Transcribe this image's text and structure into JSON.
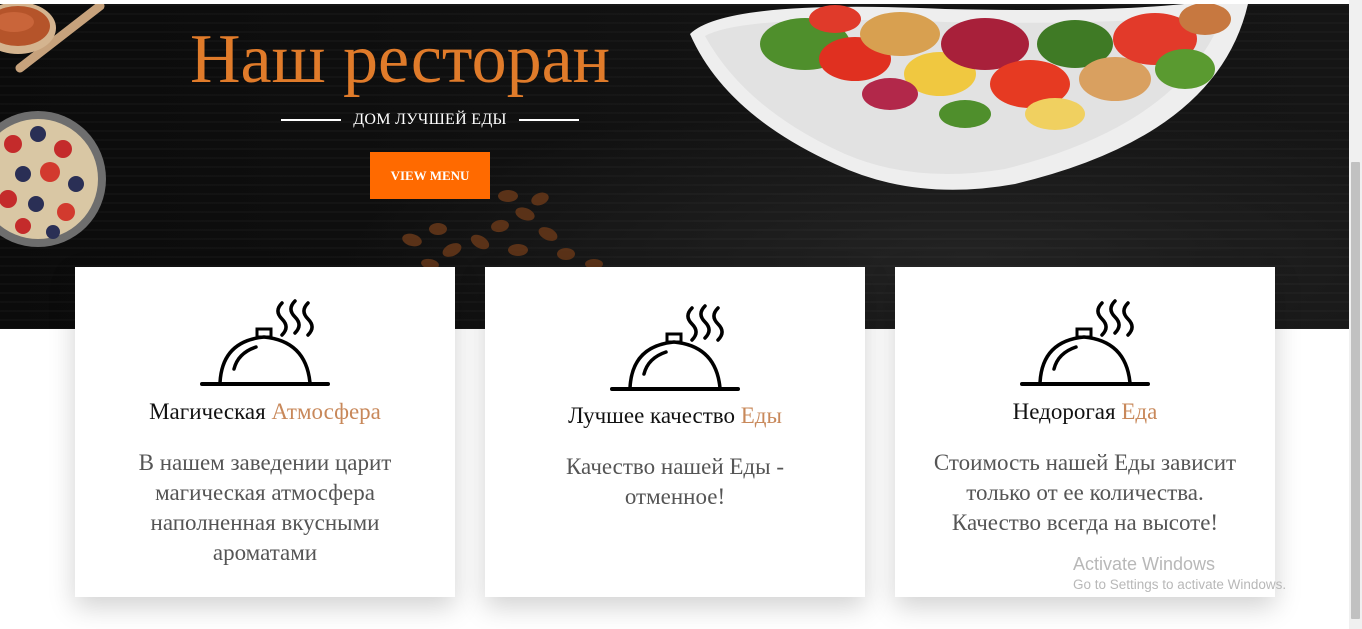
{
  "hero": {
    "title": "Наш ресторан",
    "subtitle": "ДОМ ЛУЧШЕЙ ЕДЫ",
    "button_label": "VIEW MENU",
    "accent_color": "#e07b2a",
    "button_color": "#ff6a00"
  },
  "features": [
    {
      "title_main": "Магическая",
      "title_accent": "Атмосфера",
      "description": "В нашем заведении царит магическая атмосфера наполненная вкусными ароматами",
      "icon": "cloche-icon"
    },
    {
      "title_main": "Лучшее качество",
      "title_accent": "Еды",
      "description": "Качество нашей Еды - отменное!",
      "icon": "cloche-icon"
    },
    {
      "title_main": "Недорогая",
      "title_accent": "Еда",
      "description": "Стоимость нашей Еды зависит только от ее количества. Качество всегда на высоте!",
      "icon": "cloche-icon"
    }
  ],
  "watermark": {
    "title": "Activate Windows",
    "subtitle": "Go to Settings to activate Windows."
  }
}
